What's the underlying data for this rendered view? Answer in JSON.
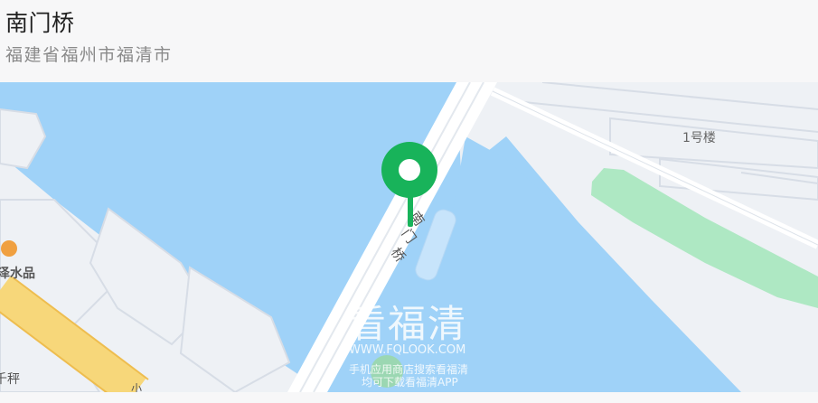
{
  "location": {
    "name": "南门桥",
    "region": "福建省福州市福清市"
  },
  "map": {
    "labels": {
      "building": "1号楼",
      "bridge_chars": [
        "南",
        "门",
        "桥"
      ],
      "poi": "泽水品",
      "poi2": "千秤",
      "road_char": "小"
    },
    "watermark": {
      "logo": "看福清",
      "url": "WWW.FQLOOK.COM",
      "line1": "手机应用商店搜索看福清",
      "line2": "均可下载看福清APP"
    },
    "pin_color": "#18b35a",
    "water_color": "#9fd2f8",
    "green_color": "#aee8c3"
  }
}
